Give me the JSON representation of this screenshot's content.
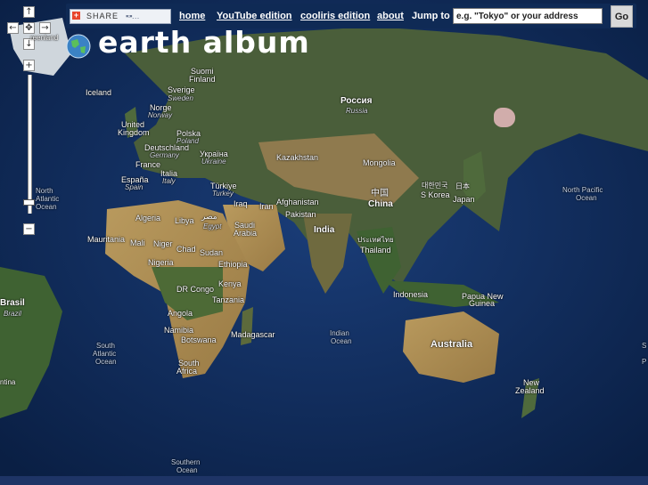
{
  "brand": {
    "title": "earth album"
  },
  "share": {
    "label": "SHARE",
    "services": "▪▫▪…"
  },
  "nav": {
    "links": [
      {
        "label": "home"
      },
      {
        "label": "YouTube edition"
      },
      {
        "label": "cooliris edition"
      },
      {
        "label": "about"
      }
    ],
    "jump_label": "Jump to",
    "search_placeholder": "e.g. \"Tokyo\" or your address",
    "go_label": "Go"
  },
  "map_controls": {
    "up": "↑",
    "down": "↓",
    "left": "←",
    "right": "→",
    "center": "✥",
    "zoom_in": "+",
    "zoom_out": "−"
  },
  "colors": {
    "bar_bg": "#0f2a55",
    "ocean": "#0b2348",
    "land": "#8a7a4a",
    "marker": "#ffc8d2"
  },
  "map_labels": {
    "countries": [
      {
        "text": "Suomi"
      },
      {
        "text": "Finland"
      },
      {
        "text": "Sverige"
      },
      {
        "text": "Sweden"
      },
      {
        "text": "Norge"
      },
      {
        "text": "Norway"
      },
      {
        "text": "Iceland"
      },
      {
        "text": "United"
      },
      {
        "text": "Kingdom"
      },
      {
        "text": "Polska"
      },
      {
        "text": "Poland"
      },
      {
        "text": "Deutschland"
      },
      {
        "text": "Germany"
      },
      {
        "text": "France"
      },
      {
        "text": "Україна"
      },
      {
        "text": "Ukraine"
      },
      {
        "text": "Italia"
      },
      {
        "text": "Italy"
      },
      {
        "text": "España"
      },
      {
        "text": "Spain"
      },
      {
        "text": "Türkiye"
      },
      {
        "text": "Turkey"
      },
      {
        "text": "Algeria"
      },
      {
        "text": "Libya"
      },
      {
        "text": "مصر"
      },
      {
        "text": "Egypt"
      },
      {
        "text": "Saudi"
      },
      {
        "text": "Arabia"
      },
      {
        "text": "Iraq"
      },
      {
        "text": "Iran"
      },
      {
        "text": "Afghanistan"
      },
      {
        "text": "Pakistan"
      },
      {
        "text": "Kazakhstan"
      },
      {
        "text": "Mongolia"
      },
      {
        "text": "India"
      },
      {
        "text": "中国"
      },
      {
        "text": "China"
      },
      {
        "text": "대한민국"
      },
      {
        "text": "S Korea"
      },
      {
        "text": "日本"
      },
      {
        "text": "Japan"
      },
      {
        "text": "ประเทศไทย"
      },
      {
        "text": "Thailand"
      },
      {
        "text": "Mauritania"
      },
      {
        "text": "Mali"
      },
      {
        "text": "Niger"
      },
      {
        "text": "Chad"
      },
      {
        "text": "Sudan"
      },
      {
        "text": "Nigeria"
      },
      {
        "text": "Ethiopia"
      },
      {
        "text": "DR Congo"
      },
      {
        "text": "Kenya"
      },
      {
        "text": "Tanzania"
      },
      {
        "text": "Angola"
      },
      {
        "text": "Namibia"
      },
      {
        "text": "Botswana"
      },
      {
        "text": "South"
      },
      {
        "text": "Africa"
      },
      {
        "text": "Madagascar"
      },
      {
        "text": "Indonesia"
      },
      {
        "text": "Papua New"
      },
      {
        "text": "Guinea"
      },
      {
        "text": "Australia"
      },
      {
        "text": "New"
      },
      {
        "text": "Zealand"
      },
      {
        "text": "Brasil"
      },
      {
        "text": "Brazil"
      },
      {
        "text": "Россия"
      },
      {
        "text": "Russia"
      },
      {
        "text": "reenland"
      },
      {
        "text": "ntina"
      }
    ],
    "oceans": [
      {
        "text": "North"
      },
      {
        "text": "Atlantic"
      },
      {
        "text": "Ocean"
      },
      {
        "text": "North Pacific"
      },
      {
        "text": "Ocean"
      },
      {
        "text": "South"
      },
      {
        "text": "Atlantic"
      },
      {
        "text": "Ocean"
      },
      {
        "text": "Indian"
      },
      {
        "text": "Ocean"
      },
      {
        "text": "Southern"
      },
      {
        "text": "Ocean"
      },
      {
        "text": "S"
      },
      {
        "text": "P"
      }
    ]
  }
}
